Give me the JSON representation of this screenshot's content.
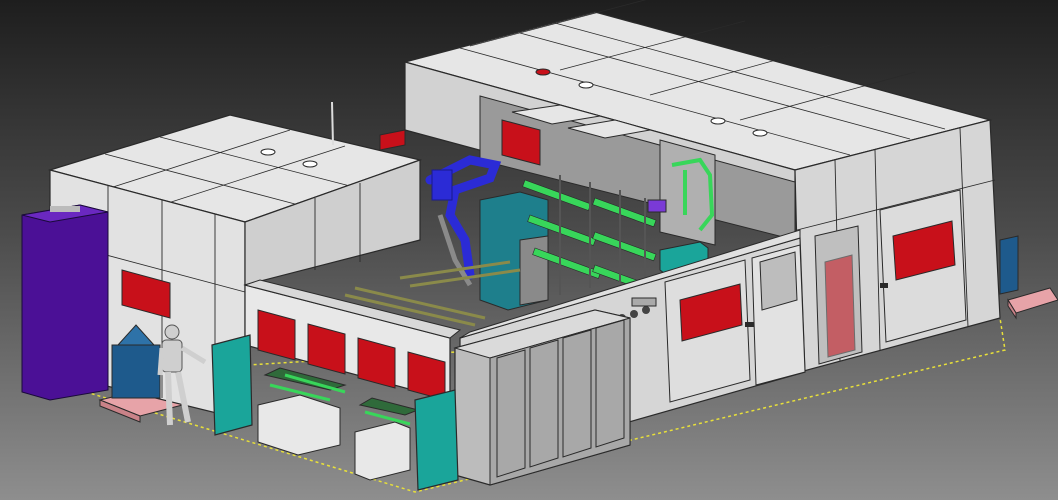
{
  "viewer": {
    "background_top": "#1e1e1e",
    "background_bottom": "#8e8e8e"
  },
  "colors": {
    "wall_light": "#e6e6e6",
    "wall_mid": "#d2d2d2",
    "wall_dark": "#b4b4b4",
    "edge": "#2a2a2a",
    "warning_panel": "#c8101a",
    "teal_door": "#1aa59a",
    "robot_blue": "#2b2bd6",
    "fixture_green": "#38d65a",
    "tower_purple": "#4b1096",
    "tank_blue": "#1e5a8c",
    "pallet_pink": "#e7a3a8",
    "floor_outline": "#e8e03a"
  },
  "scene": {
    "description_visible": false,
    "components": [
      "left-cell-enclosure",
      "right-cell-enclosure",
      "purple-cabinet",
      "blue-tank",
      "robot-arm",
      "welding-fixtures",
      "electrical-cabinets",
      "operator-mannequin",
      "pallets"
    ]
  }
}
